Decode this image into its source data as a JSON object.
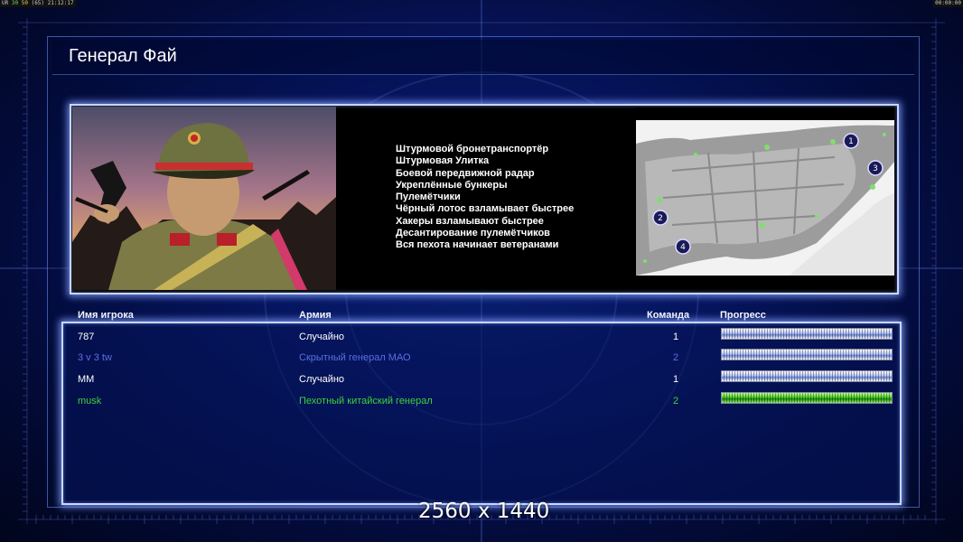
{
  "overlay": {
    "left_prefix": "UR",
    "left_a": "30",
    "left_b": "50",
    "left_c": "(65)",
    "left_time": "21:12:17",
    "right_time": "00:00:00"
  },
  "title": "Генерал Фай",
  "features": [
    "Штурмовой бронетранспортёр",
    "Штурмовая Улитка",
    "Боевой передвижной радар",
    "Укреплённые бункеры",
    "Пулемётчики",
    "Чёрный лотос взламывает быстрее",
    "Хакеры взламывают быстрее",
    "Десантирование пулемётчиков",
    "Вся пехота начинает ветеранами"
  ],
  "minimap": {
    "start_positions": [
      "1",
      "2",
      "3",
      "4"
    ]
  },
  "columns": {
    "player": "Имя игрока",
    "army": "Армия",
    "team": "Команда",
    "progress": "Прогресс"
  },
  "players": [
    {
      "name": "787",
      "army": "Случайно",
      "team": "1",
      "progress": 1.0,
      "color": "#ffffff"
    },
    {
      "name": "3 v 3 tw",
      "army": "Скрытный генерал МАО",
      "team": "2",
      "progress": 1.0,
      "color": "#5a6fe6"
    },
    {
      "name": "MM",
      "army": "Случайно",
      "team": "1",
      "progress": 1.0,
      "color": "#ffffff"
    },
    {
      "name": "musk",
      "army": "Пехотный китайский генерал",
      "team": "2",
      "progress": 1.0,
      "color": "#3fd23a"
    }
  ],
  "resolution_label": "2560 x 1440"
}
